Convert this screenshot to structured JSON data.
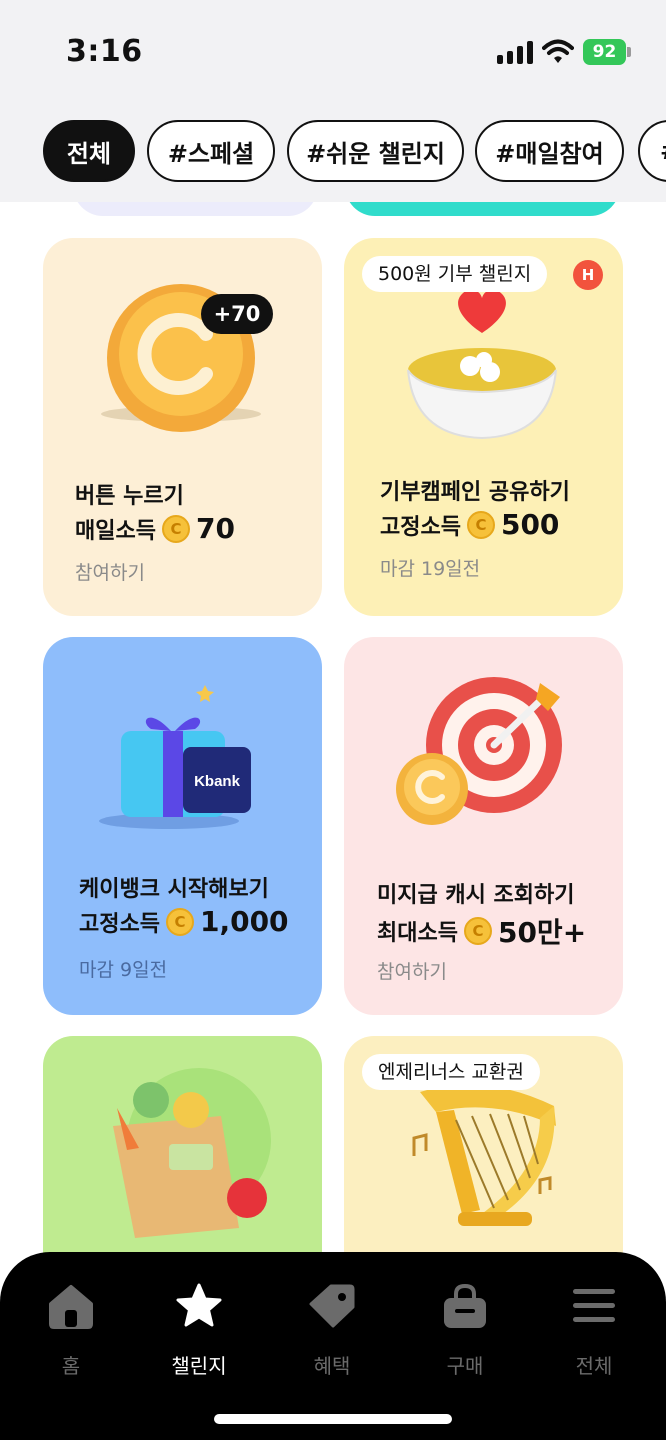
{
  "status": {
    "time": "3:16",
    "battery": "92"
  },
  "filters": [
    {
      "label": "전체",
      "active": true
    },
    {
      "label": "#스페셜",
      "active": false
    },
    {
      "label": "#쉬운 챌린지",
      "active": false
    },
    {
      "label": "#매일참여",
      "active": false
    },
    {
      "label": "#",
      "active": false
    }
  ],
  "cards": [
    {
      "title": "버튼 누르기",
      "income_label": "매일소득",
      "coin_glyph": "C",
      "amount": "70",
      "sub": "참여하기",
      "badge": "+70",
      "bg": "#fdefd6"
    },
    {
      "title": "기부캠페인 공유하기",
      "income_label": "고정소득",
      "coin_glyph": "C",
      "amount": "500",
      "sub": "마감 19일전",
      "tag": "500원 기부 챌린지",
      "hot": "H",
      "bg": "#fdf0b6"
    },
    {
      "title": "케이뱅크 시작해보기",
      "income_label": "고정소득",
      "coin_glyph": "C",
      "amount": "1,000",
      "sub": "마감 9일전",
      "logo": "Kbank",
      "bg": "#8ebdfb"
    },
    {
      "title": "미지급 캐시 조회하기",
      "income_label": "최대소득",
      "coin_glyph": "C",
      "amount": "50만+",
      "sub": "참여하기",
      "bg": "#fde5e5"
    },
    {
      "bg": "#bfeb90"
    },
    {
      "tag": "엔제리너스 교환권",
      "bg": "#fcefc0"
    }
  ],
  "nav": [
    {
      "label": "홈",
      "icon": "home-icon",
      "active": false
    },
    {
      "label": "챌린지",
      "icon": "star-icon",
      "active": true
    },
    {
      "label": "혜택",
      "icon": "tag-icon",
      "active": false
    },
    {
      "label": "구매",
      "icon": "shopping-bag-icon",
      "active": false
    },
    {
      "label": "전체",
      "icon": "menu-icon",
      "active": false
    }
  ],
  "colors": {
    "accent": "#111111",
    "coin": "#f6c13a",
    "hot_badge": "#f2533d",
    "battery": "#34c759"
  }
}
